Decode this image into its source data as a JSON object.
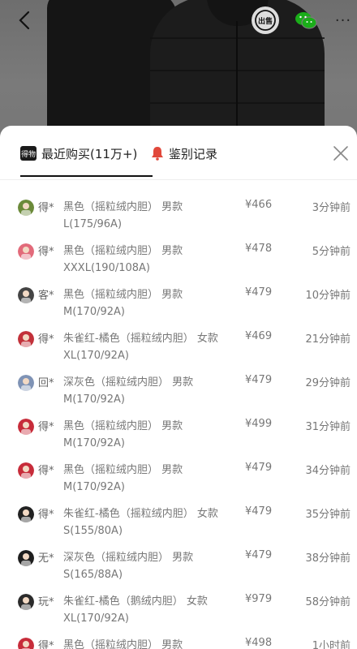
{
  "header": {
    "back_icon": "back-arrow-icon",
    "share_label": "出售",
    "wechat_icon": "wechat-icon",
    "more_label": "···"
  },
  "tabs": {
    "recent_badge": "得物",
    "recent_label": "最近购买(11万+)",
    "auth_label": "鉴别记录",
    "auth_icon": "bell-icon",
    "close_icon": "close-icon"
  },
  "colors": {
    "auth_icon": "#e1483b",
    "wechat": "#1aad19"
  },
  "purchases": [
    {
      "user": "得*",
      "variant": "黑色（摇粒绒内胆） 男款 L(175/96A)",
      "price": "¥466",
      "time": "3分钟前",
      "avatar_color": "#6b8a3a"
    },
    {
      "user": "得*",
      "variant": "黑色（摇粒绒内胆） 男款 XXXL(190/108A)",
      "price": "¥478",
      "time": "5分钟前",
      "avatar_color": "#e26a7a"
    },
    {
      "user": "客*",
      "variant": "黑色（摇粒绒内胆） 男款 M(170/92A)",
      "price": "¥479",
      "time": "10分钟前",
      "avatar_color": "#444444"
    },
    {
      "user": "得*",
      "variant": "朱雀红-橘色（摇粒绒内胆） 女款 XL(170/92A)",
      "price": "¥469",
      "time": "21分钟前",
      "avatar_color": "#c2313a"
    },
    {
      "user": "回*",
      "variant": "深灰色（摇粒绒内胆） 男款 M(170/92A)",
      "price": "¥479",
      "time": "29分钟前",
      "avatar_color": "#7f93b5"
    },
    {
      "user": "得*",
      "variant": "黑色（摇粒绒内胆） 男款 M(170/92A)",
      "price": "¥499",
      "time": "31分钟前",
      "avatar_color": "#c72c3a"
    },
    {
      "user": "得*",
      "variant": "黑色（摇粒绒内胆） 男款 M(170/92A)",
      "price": "¥479",
      "time": "34分钟前",
      "avatar_color": "#c72c3a"
    },
    {
      "user": "得*",
      "variant": "朱雀红-橘色（摇粒绒内胆） 女款 S(155/80A)",
      "price": "¥479",
      "time": "35分钟前",
      "avatar_color": "#222222"
    },
    {
      "user": "无*",
      "variant": "深灰色（摇粒绒内胆） 男款 S(165/88A)",
      "price": "¥479",
      "time": "38分钟前",
      "avatar_color": "#1e1e1e"
    },
    {
      "user": "玩*",
      "variant": "朱雀红-橘色（鹅绒内胆） 女款 XL(170/92A)",
      "price": "¥979",
      "time": "58分钟前",
      "avatar_color": "#2b2b2b"
    },
    {
      "user": "得*",
      "variant": "黑色（摇粒绒内胆） 男款",
      "price": "¥498",
      "time": "1小时前",
      "avatar_color": "#c72c3a"
    }
  ]
}
